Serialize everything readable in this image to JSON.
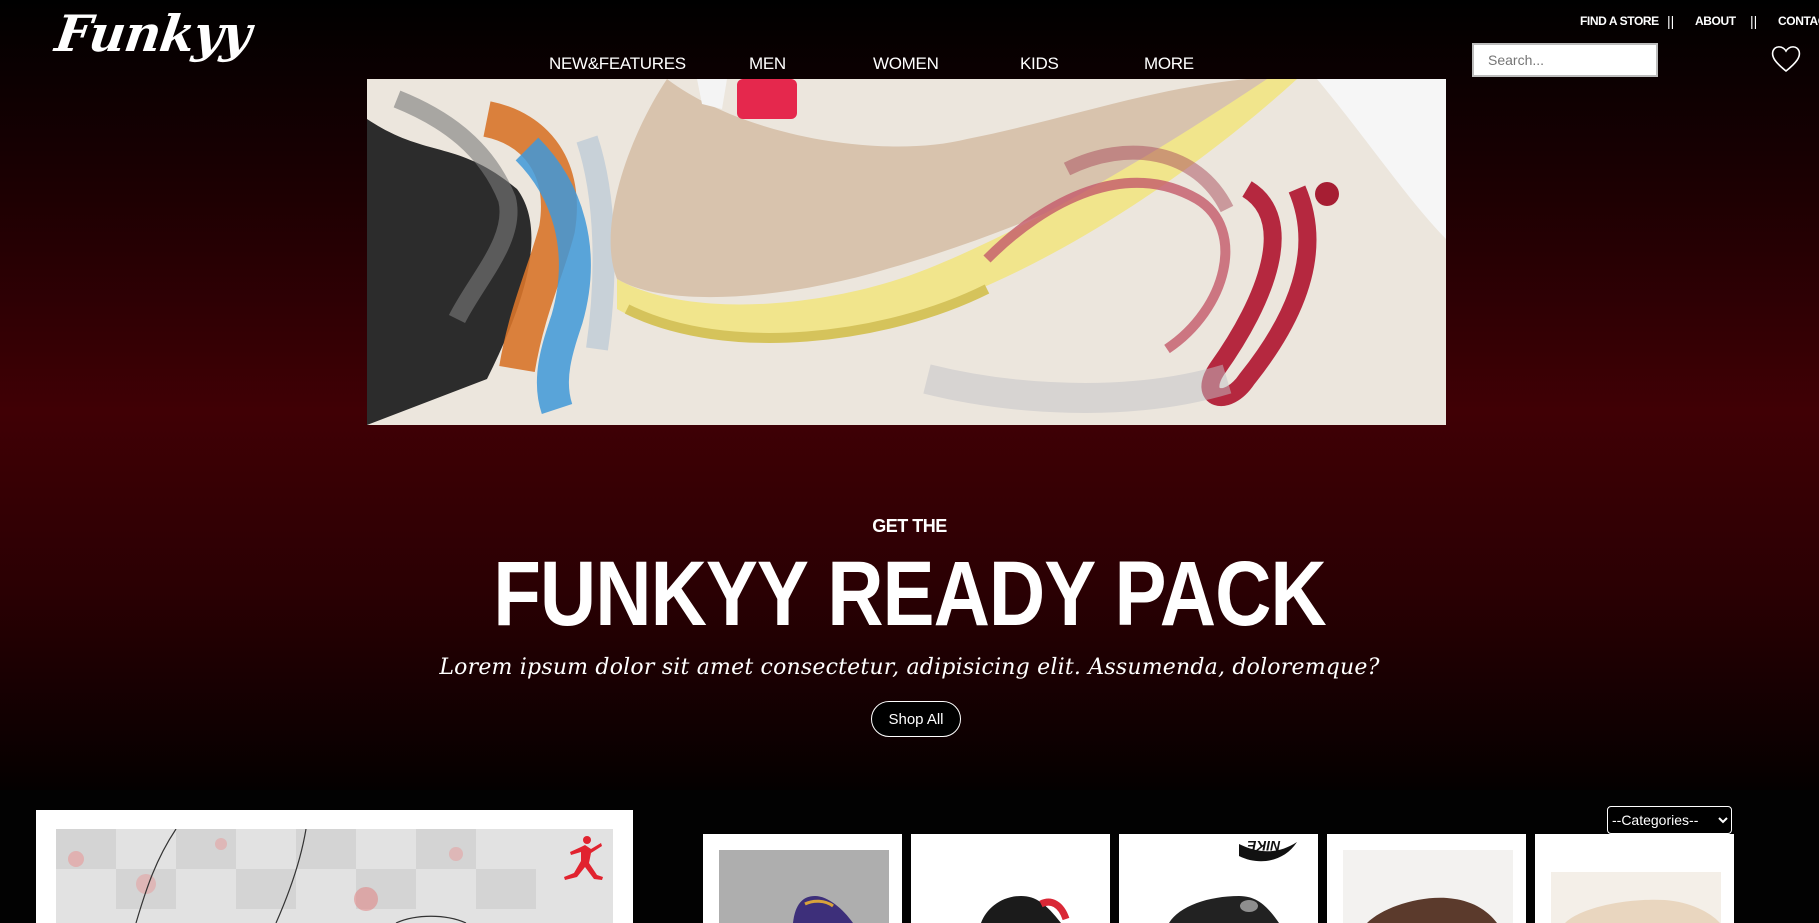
{
  "brand": {
    "logo_text": "Funkyy"
  },
  "nav": {
    "items": [
      {
        "label": "NEW&FEATURES"
      },
      {
        "label": "MEN"
      },
      {
        "label": "WOMEN"
      },
      {
        "label": "KIDS"
      },
      {
        "label": "MORE"
      }
    ]
  },
  "utility_nav": {
    "find_store": "FIND A STORE",
    "separator": "||",
    "about": "ABOUT",
    "contact": "CONTACT"
  },
  "search": {
    "placeholder": "Search..."
  },
  "icons": {
    "wishlist": "heart-icon",
    "brand_mark": "jumpman-logo",
    "swoosh_text": "NIKE"
  },
  "hero": {
    "kicker": "GET THE",
    "headline": "FUNKYY READY PACK",
    "subline": "Lorem ipsum dolor sit amet consectetur, adipisicing elit. Assumenda, doloremque?",
    "cta_label": "Shop All"
  },
  "filters": {
    "categories_selected": "--Categories--"
  },
  "colors": {
    "accent_red": "#400005",
    "background": "#000000",
    "text": "#ffffff"
  }
}
